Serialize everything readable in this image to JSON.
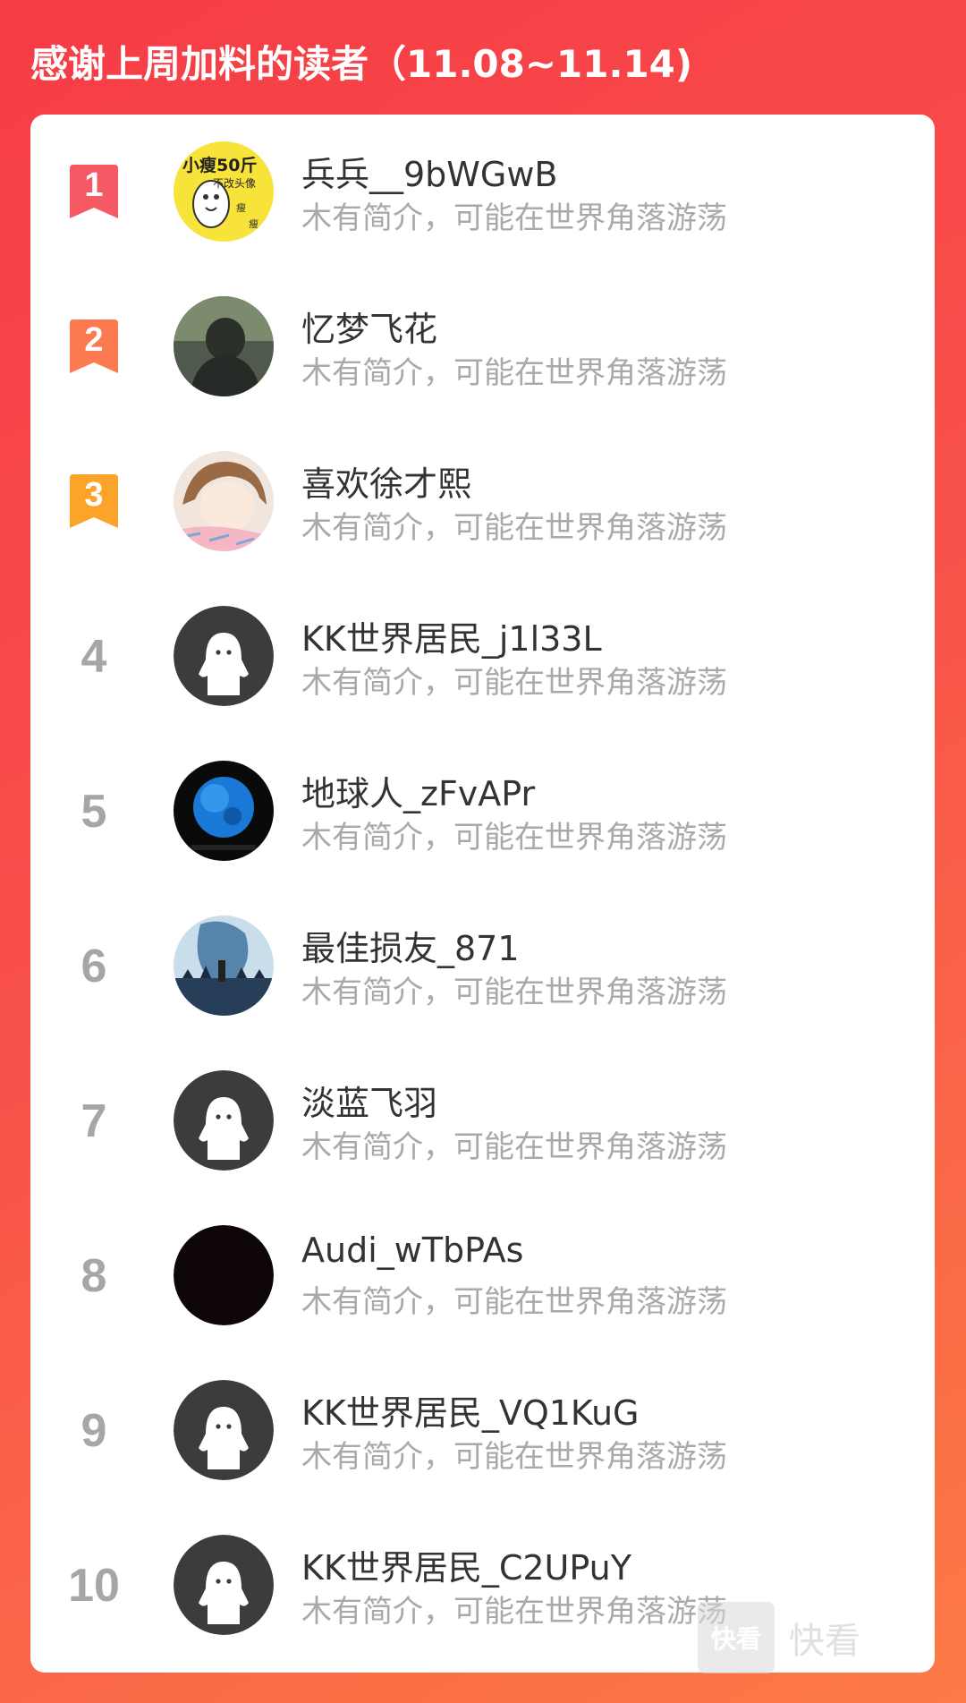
{
  "header": {
    "title": "感谢上周加料的读者（11.08~11.14)"
  },
  "readers": [
    {
      "rank": "1",
      "name": "兵兵__9bWGwB",
      "bio": "木有简介，可能在世界角落游荡",
      "avatar_text_1": "小瘦50斤",
      "avatar_text_2": "不改头像"
    },
    {
      "rank": "2",
      "name": "忆梦飞花",
      "bio": "木有简介，可能在世界角落游荡"
    },
    {
      "rank": "3",
      "name": "喜欢徐才熙",
      "bio": "木有简介，可能在世界角落游荡"
    },
    {
      "rank": "4",
      "name": "KK世界居民_j1l33L",
      "bio": "木有简介，可能在世界角落游荡"
    },
    {
      "rank": "5",
      "name": "地球人_zFvAPr",
      "bio": "木有简介，可能在世界角落游荡"
    },
    {
      "rank": "6",
      "name": "最佳损友_871",
      "bio": "木有简介，可能在世界角落游荡"
    },
    {
      "rank": "7",
      "name": "淡蓝飞羽",
      "bio": "木有简介，可能在世界角落游荡"
    },
    {
      "rank": "8",
      "name": "Audi_wTbPAs",
      "bio": "木有简介，可能在世界角落游荡"
    },
    {
      "rank": "9",
      "name": "KK世界居民_VQ1KuG",
      "bio": "木有简介，可能在世界角落游荡"
    },
    {
      "rank": "10",
      "name": "KK世界居民_C2UPuY",
      "bio": "木有简介，可能在世界角落游荡"
    }
  ],
  "watermark": {
    "logo_text": "快看",
    "text": "快看"
  },
  "colors": {
    "rank1": "#f55a64",
    "rank2": "#fb7a52",
    "rank3": "#fca42a",
    "rank_other": "#a6a6a6",
    "default_avatar_bg": "#3c3c3c"
  },
  "icons": {
    "rank_top": "ribbon-badge-icon",
    "default_avatar": "ghost-avatar-icon"
  }
}
